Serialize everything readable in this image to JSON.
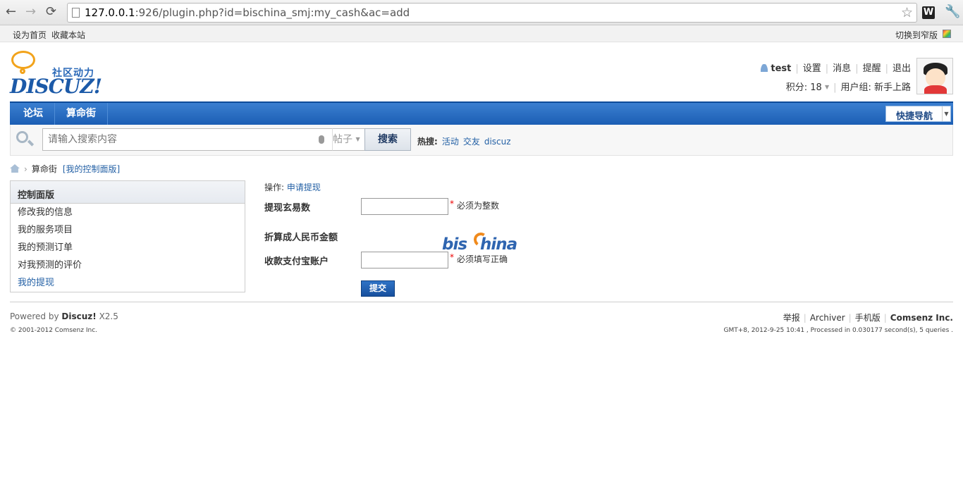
{
  "browser": {
    "url_host": "127.0.0.1",
    "url_rest": ":926/plugin.php?id=bischina_smj:my_cash&ac=add",
    "back_icon": "arrow-left-icon",
    "forward_icon": "arrow-right-icon",
    "reload_icon": "reload-icon"
  },
  "topbar": {
    "set_home": "设为首页",
    "bookmark": "收藏本站",
    "narrow": "切换到窄版"
  },
  "logo": {
    "slogan": "社区动力",
    "word": "DISCUZ!"
  },
  "user": {
    "name": "test",
    "settings": "设置",
    "messages": "消息",
    "reminders": "提醒",
    "logout": "退出",
    "credits_label": "积分: 18",
    "group_label": "用户组: 新手上路"
  },
  "nav": {
    "items": [
      "论坛",
      "算命街"
    ],
    "quicknav": "快捷导航"
  },
  "search": {
    "placeholder": "请输入搜索内容",
    "type": "帖子",
    "button": "搜索",
    "hot_label": "热搜:",
    "hot_items": [
      "活动",
      "交友",
      "discuz"
    ]
  },
  "breadcrumb": {
    "section": "算命街",
    "link": "[我的控制面版]"
  },
  "sidebar": {
    "title": "控制面版",
    "items": [
      "修改我的信息",
      "我的服务项目",
      "我的预测订单",
      "对我预测的评价",
      "我的提现"
    ]
  },
  "form": {
    "ops_label": "操作:",
    "ops_link": "申请提现",
    "amount_label": "提现玄易数",
    "amount_value": "",
    "amount_hint": "必须为整数",
    "rmb_label": "折算成人民币金额",
    "account_label": "收款支付宝账户",
    "account_value": "",
    "account_hint": "必须填写正确",
    "submit": "提交"
  },
  "watermark": {
    "left": "bis",
    "right": "hina"
  },
  "footer": {
    "powered_prefix": "Powered by",
    "powered_brand": "Discuz!",
    "powered_version": "X2.5",
    "copyright": "© 2001-2012 Comsenz Inc.",
    "links": [
      "举报",
      "Archiver",
      "手机版"
    ],
    "company": "Comsenz Inc.",
    "stats": "GMT+8, 2012-9-25 10:41 , Processed in 0.030177 second(s), 5 queries ."
  }
}
